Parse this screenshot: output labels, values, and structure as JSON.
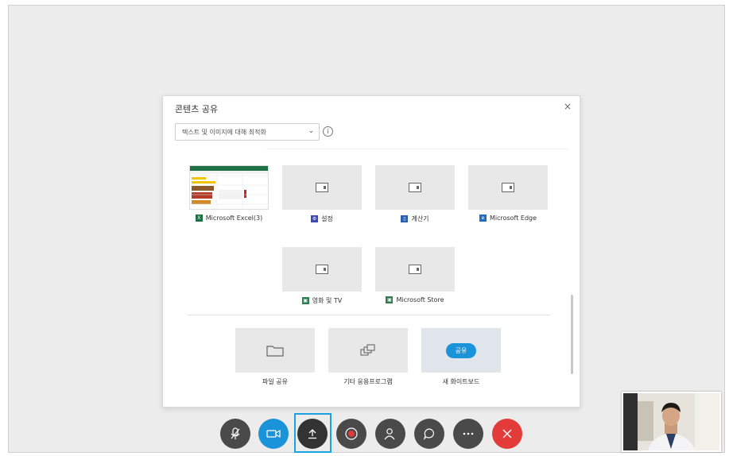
{
  "dialog": {
    "title": "콘텐츠 공유",
    "close_glyph": "×",
    "optimize_select": "텍스트 및 이미지에 대해 최적화",
    "info_glyph": "i"
  },
  "windows": [
    {
      "name": "Microsoft Excel(3)",
      "icon": "excel-icon",
      "color": "#1e7145",
      "glyph": "X"
    },
    {
      "name": "설정",
      "icon": "settings-icon",
      "color": "#3b4bb3",
      "glyph": "⚙"
    },
    {
      "name": "계산기",
      "icon": "calculator-icon",
      "color": "#2b5fad",
      "glyph": "▯"
    },
    {
      "name": "Microsoft Edge",
      "icon": "edge-icon",
      "color": "#1e6fc4",
      "glyph": "e"
    },
    {
      "name": "영화 및 TV",
      "icon": "movies-tv-icon",
      "color": "#2e7d4f",
      "glyph": "▣"
    },
    {
      "name": "Microsoft Store",
      "icon": "store-icon",
      "color": "#2e7d4f",
      "glyph": "▣"
    }
  ],
  "options": [
    {
      "label": "파일 공유",
      "icon": "folder-icon"
    },
    {
      "label": "기타 응용프로그램",
      "icon": "other-apps-icon"
    },
    {
      "label": "새 화이트보드",
      "icon": "whiteboard-icon",
      "button": "공유"
    }
  ],
  "toolbar": [
    {
      "name": "mute-button",
      "icon": "mic-off-icon",
      "glyph": "🎙",
      "style": "dark-grey"
    },
    {
      "name": "video-button",
      "icon": "camera-icon",
      "glyph": "▭",
      "style": "blue"
    },
    {
      "name": "share-content-button",
      "icon": "upload-icon",
      "glyph": "⭱",
      "style": "dark"
    },
    {
      "name": "record-button",
      "icon": "record-icon",
      "glyph": "◉",
      "style": "dark-grey"
    },
    {
      "name": "participants-button",
      "icon": "participants-icon",
      "glyph": "👤",
      "style": "dark-grey"
    },
    {
      "name": "chat-button",
      "icon": "chat-icon",
      "glyph": "💬",
      "style": "dark-grey"
    },
    {
      "name": "more-button",
      "icon": "more-icon",
      "glyph": "···",
      "style": "dark-grey"
    },
    {
      "name": "leave-button",
      "icon": "close-icon",
      "glyph": "✕",
      "style": "red"
    }
  ],
  "colors": {
    "accent": "#1a93d8",
    "leave": "#e33a3a",
    "highlight": "#1aa3e0"
  }
}
